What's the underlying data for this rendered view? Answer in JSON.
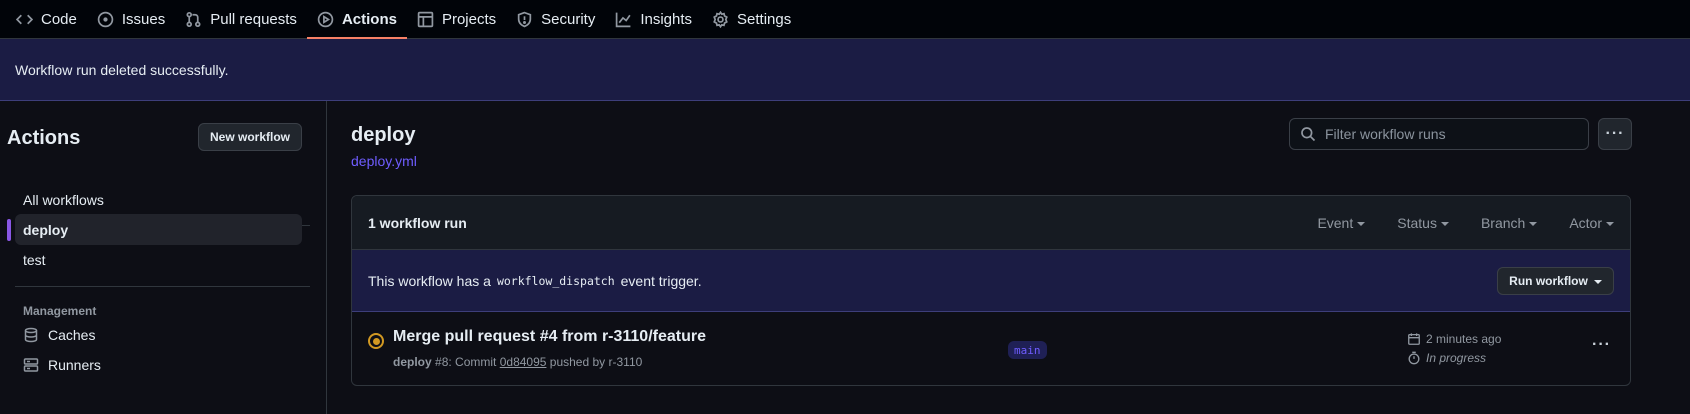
{
  "nav": {
    "tabs": [
      {
        "label": "Code",
        "icon": "code-icon"
      },
      {
        "label": "Issues",
        "icon": "issue-opened-icon"
      },
      {
        "label": "Pull requests",
        "icon": "git-pull-request-icon"
      },
      {
        "label": "Actions",
        "icon": "play-icon",
        "active": true
      },
      {
        "label": "Projects",
        "icon": "table-icon"
      },
      {
        "label": "Security",
        "icon": "shield-icon"
      },
      {
        "label": "Insights",
        "icon": "graph-icon"
      },
      {
        "label": "Settings",
        "icon": "gear-icon"
      }
    ]
  },
  "flash": {
    "message": "Workflow run deleted successfully."
  },
  "sidebar": {
    "title": "Actions",
    "new_workflow_label": "New workflow",
    "all_workflows_label": "All workflows",
    "workflows": [
      {
        "label": "deploy",
        "active": true
      },
      {
        "label": "test",
        "active": false
      }
    ],
    "management_heading": "Management",
    "management_items": [
      {
        "label": "Caches",
        "icon": "database-icon"
      },
      {
        "label": "Runners",
        "icon": "server-icon"
      }
    ]
  },
  "main": {
    "workflow_title": "deploy",
    "workflow_file": "deploy.yml",
    "filter_placeholder": "Filter workflow runs",
    "more_label": "···",
    "runs_count": "1 workflow run",
    "filters": [
      "Event",
      "Status",
      "Branch",
      "Actor"
    ],
    "dispatch": {
      "prefix": "This workflow has a",
      "code": "workflow_dispatch",
      "suffix": "event trigger.",
      "button_label": "Run workflow"
    },
    "runs": [
      {
        "title": "Merge pull request #4 from r-3110/feature",
        "workflow": "deploy",
        "run_number": "#8",
        "commit_prefix": ": Commit",
        "sha": "0d84095",
        "pushed_by": "pushed by r-3110",
        "branch": "main",
        "time": "2 minutes ago",
        "status": "In progress",
        "more_label": "···"
      }
    ]
  },
  "colors": {
    "accent": "#8957e5",
    "link": "#6f5dff",
    "flash_bg": "#1b1c44",
    "in_progress": "#d29922",
    "active_tab_underline": "#f78166"
  }
}
